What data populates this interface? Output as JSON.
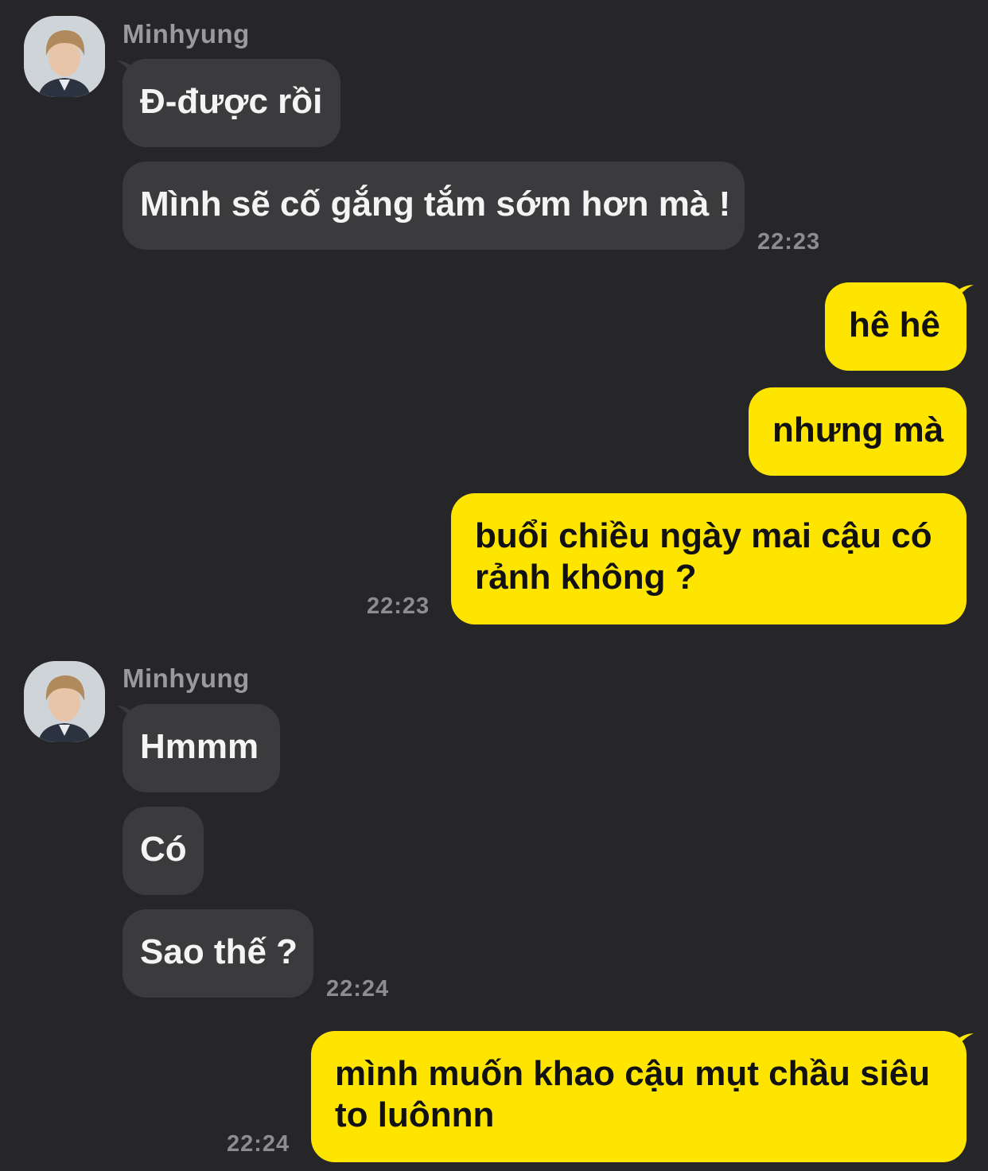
{
  "colors": {
    "background": "#262628",
    "incoming_bubble": "#3b3b3e",
    "outgoing_bubble": "#fee500"
  },
  "groups": [
    {
      "sender": "Minhyung",
      "messages": [
        "Đ-được rồi",
        "Mình sẽ cố gắng tắm sớm hơn mà !"
      ],
      "time": "22:23"
    },
    {
      "messages": [
        "hê hê",
        "nhưng mà",
        "buổi chiều ngày mai cậu có rảnh không ?"
      ],
      "time": "22:23"
    },
    {
      "sender": "Minhyung",
      "messages": [
        "Hmmm",
        "Có",
        "Sao thế ?"
      ],
      "time": "22:24"
    },
    {
      "messages": [
        "mình muốn khao cậu mụt chầu siêu to luônnn"
      ],
      "time": "22:24"
    }
  ]
}
